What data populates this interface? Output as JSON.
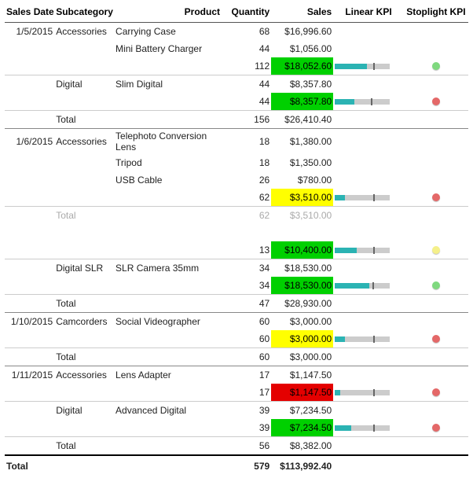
{
  "headers": {
    "sales_date": "Sales Date",
    "subcategory": "Subcategory",
    "product": "Product",
    "quantity": "Quantity",
    "sales": "Sales",
    "linear_kpi": "Linear KPI",
    "stoplight_kpi": "Stoplight KPI"
  },
  "total_label": "Total",
  "grand": {
    "qty": "579",
    "sales": "$113,992.40"
  },
  "groups": [
    {
      "date": "1/5/2015",
      "subs": [
        {
          "name": "Accessories",
          "items": [
            {
              "product": "Carrying Case",
              "qty": "68",
              "sales": "$16,996.60"
            },
            {
              "product": "Mini Battery Charger",
              "qty": "44",
              "sales": "$1,056.00"
            }
          ],
          "subtotal": {
            "qty": "112",
            "sales": "$18,052.60",
            "sales_color": "green",
            "kpi": {
              "fill": 58,
              "mark": 70
            },
            "dot": "green"
          }
        },
        {
          "name": "Digital",
          "items": [
            {
              "product": "Slim Digital",
              "qty": "44",
              "sales": "$8,357.80"
            }
          ],
          "subtotal": {
            "qty": "44",
            "sales": "$8,357.80",
            "sales_color": "green",
            "kpi": {
              "fill": 35,
              "mark": 65
            },
            "dot": "red"
          }
        }
      ],
      "total": {
        "qty": "156",
        "sales": "$26,410.40"
      }
    },
    {
      "date": "1/6/2015",
      "subs": [
        {
          "name": "Accessories",
          "items": [
            {
              "product": "Telephoto Conversion Lens",
              "qty": "18",
              "sales": "$1,380.00",
              "wrap": true
            },
            {
              "product": "Tripod",
              "qty": "18",
              "sales": "$1,350.00"
            },
            {
              "product": "USB Cable",
              "qty": "26",
              "sales": "$780.00"
            }
          ],
          "subtotal": {
            "qty": "62",
            "sales": "$3,510.00",
            "sales_color": "yellow",
            "kpi": {
              "fill": 18,
              "mark": 70
            },
            "dot": "red"
          }
        }
      ],
      "muted_total": {
        "qty": "62",
        "sales": "$3,510.00"
      }
    },
    {
      "date": "",
      "subs": [
        {
          "name": "",
          "items": [],
          "subtotal": {
            "qty": "13",
            "sales": "$10,400.00",
            "sales_color": "green",
            "kpi": {
              "fill": 40,
              "mark": 70
            },
            "dot": "yellow"
          }
        },
        {
          "name": "Digital SLR",
          "items": [
            {
              "product": "SLR Camera 35mm",
              "qty": "34",
              "sales": "$18,530.00"
            }
          ],
          "subtotal": {
            "qty": "34",
            "sales": "$18,530.00",
            "sales_color": "green",
            "kpi": {
              "fill": 62,
              "mark": 68
            },
            "dot": "green"
          }
        }
      ],
      "total": {
        "qty": "47",
        "sales": "$28,930.00"
      }
    },
    {
      "date": "1/10/2015",
      "subs": [
        {
          "name": "Camcorders",
          "items": [
            {
              "product": "Social Videographer",
              "qty": "60",
              "sales": "$3,000.00"
            }
          ],
          "subtotal": {
            "qty": "60",
            "sales": "$3,000.00",
            "sales_color": "yellow",
            "kpi": {
              "fill": 18,
              "mark": 70
            },
            "dot": "red"
          }
        }
      ],
      "total": {
        "qty": "60",
        "sales": "$3,000.00"
      }
    },
    {
      "date": "1/11/2015",
      "subs": [
        {
          "name": "Accessories",
          "items": [
            {
              "product": "Lens Adapter",
              "qty": "17",
              "sales": "$1,147.50"
            }
          ],
          "subtotal": {
            "qty": "17",
            "sales": "$1,147.50",
            "sales_color": "red",
            "kpi": {
              "fill": 10,
              "mark": 70
            },
            "dot": "red"
          }
        },
        {
          "name": "Digital",
          "items": [
            {
              "product": "Advanced Digital",
              "qty": "39",
              "sales": "$7,234.50"
            }
          ],
          "subtotal": {
            "qty": "39",
            "sales": "$7,234.50",
            "sales_color": "green",
            "kpi": {
              "fill": 30,
              "mark": 70
            },
            "dot": "red"
          }
        }
      ],
      "total": {
        "qty": "56",
        "sales": "$8,382.00"
      }
    }
  ]
}
